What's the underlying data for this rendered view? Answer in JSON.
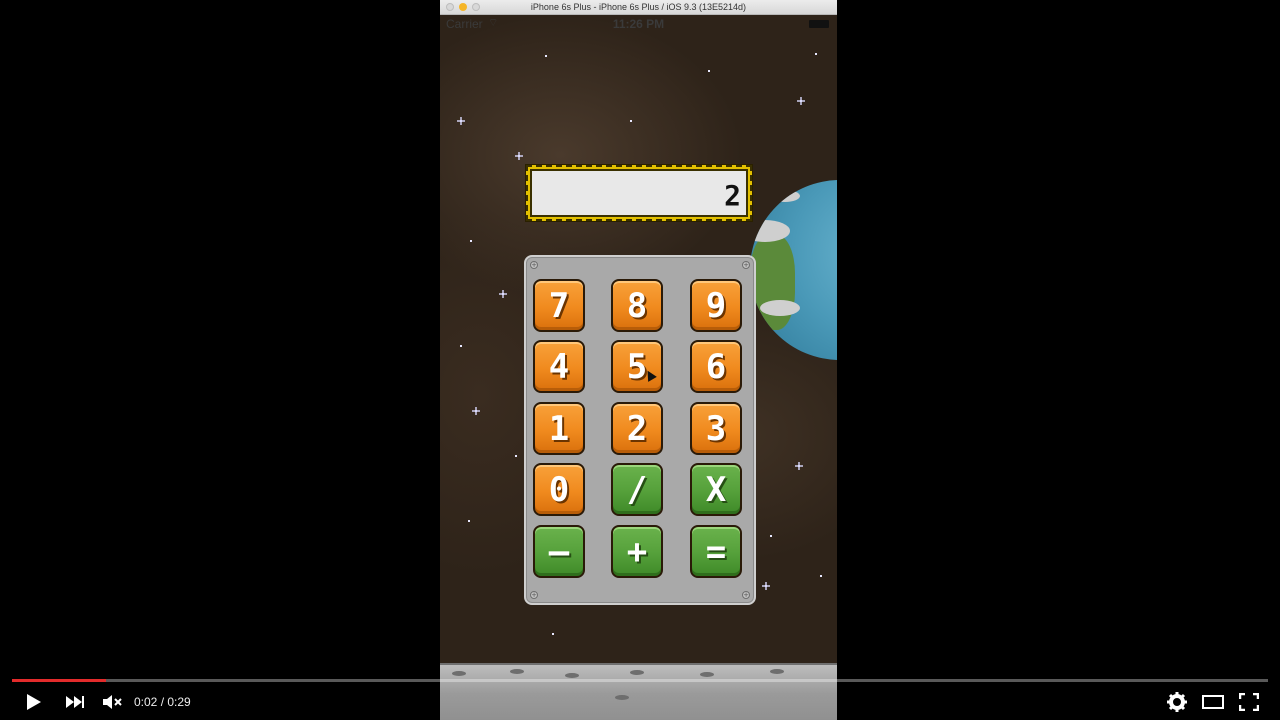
{
  "simulator": {
    "title": "iPhone 6s Plus - iPhone 6s Plus / iOS 9.3 (13E5214d)"
  },
  "status_bar": {
    "carrier": "Carrier",
    "time": "11:26 PM"
  },
  "calculator": {
    "display_value": "2",
    "keys": [
      {
        "label": "7",
        "color": "orange"
      },
      {
        "label": "8",
        "color": "orange"
      },
      {
        "label": "9",
        "color": "orange"
      },
      {
        "label": "4",
        "color": "orange"
      },
      {
        "label": "5",
        "color": "orange"
      },
      {
        "label": "6",
        "color": "orange"
      },
      {
        "label": "1",
        "color": "orange"
      },
      {
        "label": "2",
        "color": "orange"
      },
      {
        "label": "3",
        "color": "orange"
      },
      {
        "label": "0",
        "color": "orange"
      },
      {
        "label": "/",
        "color": "green"
      },
      {
        "label": "X",
        "color": "green"
      },
      {
        "label": "—",
        "color": "green"
      },
      {
        "label": "+",
        "color": "green"
      },
      {
        "label": "=",
        "color": "green"
      }
    ]
  },
  "player": {
    "time": "0:02 / 0:29",
    "progress_fraction": 0.075,
    "accent_color": "#e32b2b",
    "icons": [
      "play-icon",
      "next-icon",
      "mute-icon",
      "settings-icon",
      "theater-mode-icon",
      "fullscreen-icon"
    ]
  }
}
